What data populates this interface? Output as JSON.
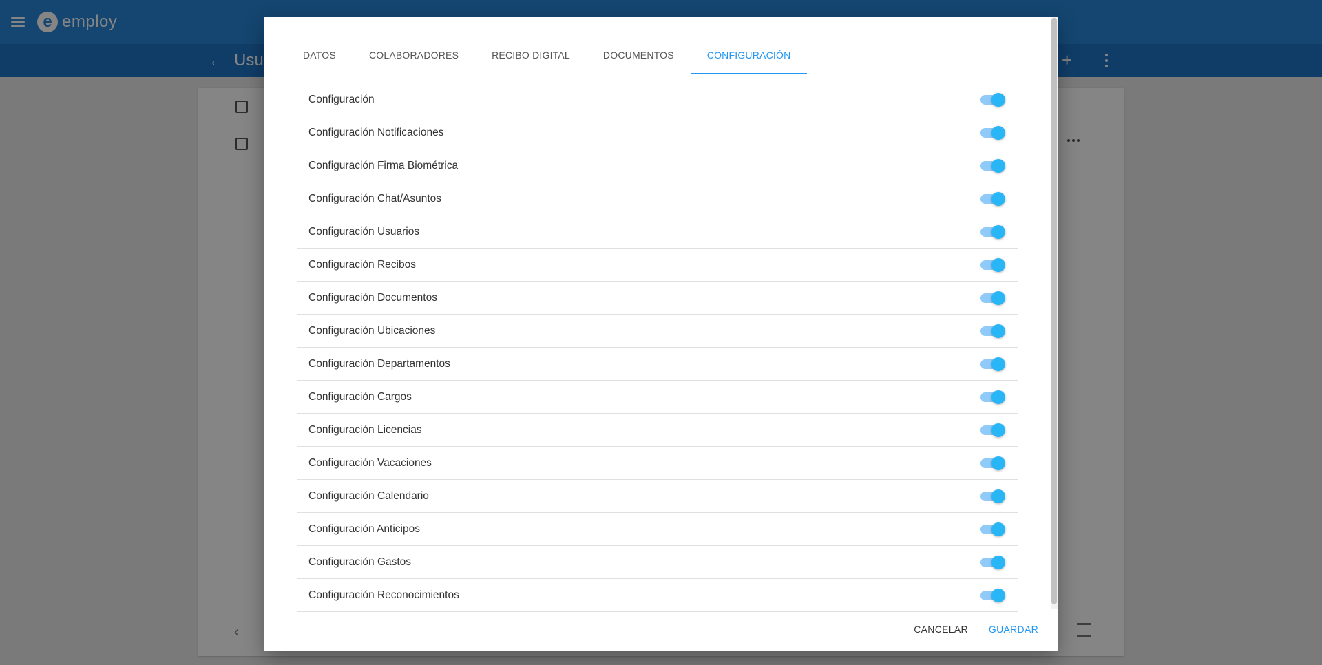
{
  "app": {
    "logo_mark": "e",
    "logo_text": "employ",
    "page_title": "Usu"
  },
  "dialog": {
    "tabs": [
      {
        "label": "DATOS",
        "active": false
      },
      {
        "label": "COLABORADORES",
        "active": false
      },
      {
        "label": "RECIBO DIGITAL",
        "active": false
      },
      {
        "label": "DOCUMENTOS",
        "active": false
      },
      {
        "label": "CONFIGURACIÓN",
        "active": true
      }
    ],
    "items": [
      {
        "label": "Configuración",
        "enabled": true
      },
      {
        "label": "Configuración Notificaciones",
        "enabled": true
      },
      {
        "label": "Configuración Firma Biométrica",
        "enabled": true
      },
      {
        "label": "Configuración Chat/Asuntos",
        "enabled": true
      },
      {
        "label": "Configuración Usuarios",
        "enabled": true
      },
      {
        "label": "Configuración Recibos",
        "enabled": true
      },
      {
        "label": "Configuración Documentos",
        "enabled": true
      },
      {
        "label": "Configuración Ubicaciones",
        "enabled": true
      },
      {
        "label": "Configuración Departamentos",
        "enabled": true
      },
      {
        "label": "Configuración Cargos",
        "enabled": true
      },
      {
        "label": "Configuración Licencias",
        "enabled": true
      },
      {
        "label": "Configuración Vacaciones",
        "enabled": true
      },
      {
        "label": "Configuración Calendario",
        "enabled": true
      },
      {
        "label": "Configuración Anticipos",
        "enabled": true
      },
      {
        "label": "Configuración Gastos",
        "enabled": true
      },
      {
        "label": "Configuración Reconocimientos",
        "enabled": true
      }
    ],
    "cancel_label": "CANCELAR",
    "save_label": "GUARDAR"
  },
  "colors": {
    "primary": "#2786d8",
    "accent": "#2196f3",
    "switch_on": "#29b6f6"
  }
}
